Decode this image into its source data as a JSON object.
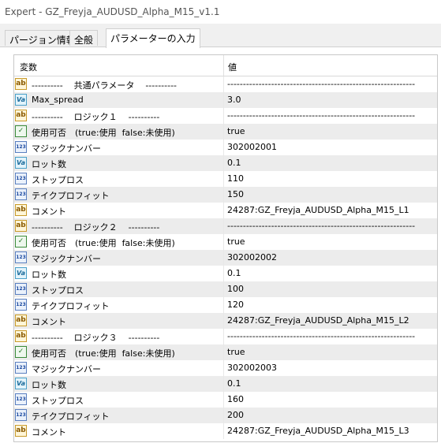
{
  "window": {
    "title": "Expert - GZ_Freyja_AUDUSD_Alpha_M15_v1.1"
  },
  "tabs": [
    {
      "label": "パージョン情報"
    },
    {
      "label": "全般"
    },
    {
      "label": "パラメーターの入力"
    }
  ],
  "grid": {
    "header": {
      "name": "変数",
      "value": "値"
    },
    "rows": [
      {
        "icon": "ab",
        "name": "----------    共通パラメータ    ----------",
        "value": "------------------------------------------------------------"
      },
      {
        "icon": "va",
        "name": "Max_spread",
        "value": "3.0"
      },
      {
        "icon": "ab",
        "name": "----------    ロジック１    ----------",
        "value": "------------------------------------------------------------"
      },
      {
        "icon": "bool",
        "name": "使用可否　(true:使用  false:未使用)",
        "value": "true"
      },
      {
        "icon": "num",
        "name": "マジックナンバー",
        "value": "302002001"
      },
      {
        "icon": "va",
        "name": "ロット数",
        "value": "0.1"
      },
      {
        "icon": "num",
        "name": "ストップロス",
        "value": "110"
      },
      {
        "icon": "num",
        "name": "テイクプロフィット",
        "value": "150"
      },
      {
        "icon": "ab",
        "name": "コメント",
        "value": "24287:GZ_Freyja_AUDUSD_Alpha_M15_L1"
      },
      {
        "icon": "ab",
        "name": "----------    ロジック２    ----------",
        "value": "------------------------------------------------------------"
      },
      {
        "icon": "bool",
        "name": "使用可否　(true:使用  false:未使用)",
        "value": "true"
      },
      {
        "icon": "num",
        "name": "マジックナンバー",
        "value": "302002002"
      },
      {
        "icon": "va",
        "name": "ロット数",
        "value": "0.1"
      },
      {
        "icon": "num",
        "name": "ストップロス",
        "value": "100"
      },
      {
        "icon": "num",
        "name": "テイクプロフィット",
        "value": "120"
      },
      {
        "icon": "ab",
        "name": "コメント",
        "value": "24287:GZ_Freyja_AUDUSD_Alpha_M15_L2"
      },
      {
        "icon": "ab",
        "name": "----------    ロジック３    ----------",
        "value": "------------------------------------------------------------"
      },
      {
        "icon": "bool",
        "name": "使用可否　(true:使用  false:未使用)",
        "value": "true"
      },
      {
        "icon": "num",
        "name": "マジックナンバー",
        "value": "302002003"
      },
      {
        "icon": "va",
        "name": "ロット数",
        "value": "0.1"
      },
      {
        "icon": "num",
        "name": "ストップロス",
        "value": "160"
      },
      {
        "icon": "num",
        "name": "テイクプロフィット",
        "value": "200"
      },
      {
        "icon": "ab",
        "name": "コメント",
        "value": "24287:GZ_Freyja_AUDUSD_Alpha_M15_L3"
      }
    ]
  },
  "icons": {
    "ab": {
      "name": "string-param-icon",
      "glyph": "ab"
    },
    "va": {
      "name": "double-param-icon",
      "glyph": "Va"
    },
    "bool": {
      "name": "bool-param-icon",
      "glyph": "✓"
    },
    "num": {
      "name": "integer-param-icon",
      "glyph": "123"
    }
  }
}
